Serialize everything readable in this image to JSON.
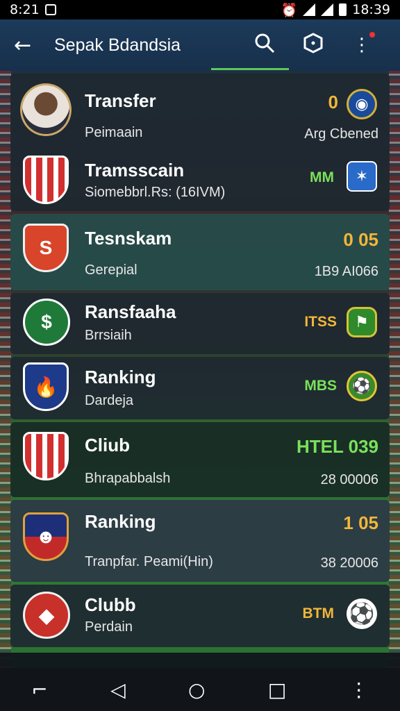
{
  "status_bar": {
    "time_left": "8:21",
    "time_right": "18:39"
  },
  "app_bar": {
    "back_icon": "arrow-left-icon",
    "title": "Sepak Bdandsia",
    "actions": [
      "search-icon",
      "shield-icon",
      "more-vert-icon"
    ]
  },
  "rows": [
    {
      "title": "Transfer",
      "subtitle": "Peimaain",
      "value": "0",
      "right_text": "Arg Cbened",
      "icon": "player-avatar"
    },
    {
      "title": "Tramsscain",
      "subtitle": "Siomebbrl.Rs: (16IVM)",
      "value": "MM",
      "icon": "club-crest"
    },
    {
      "title": "Tesnskam",
      "subtitle": "Gerepial",
      "value": "0 05",
      "right_text": "1B9 AI066",
      "icon": "club-crest"
    },
    {
      "title": "Ransfaaha",
      "subtitle": "Brrsiaih",
      "value": "ITSS",
      "icon": "club-crest"
    },
    {
      "title": "Ranking",
      "subtitle": "Dardeja",
      "value": "MBS",
      "icon": "club-crest"
    },
    {
      "title": "Cliub",
      "subtitle": "Bhrapabbalsh",
      "value": "HTEL 039",
      "right_text": "28 00006",
      "icon": "club-crest"
    },
    {
      "title": "Ranking",
      "subtitle": "Tranpfar. Peami(Hin)",
      "value": "1 05",
      "right_text": "38 20006",
      "icon": "player-crest"
    },
    {
      "title": "Clubb",
      "subtitle": "Perdain",
      "value": "BTM",
      "icon": "club-crest"
    }
  ],
  "nav_bar": [
    "recent-apps-icon",
    "back-triangle-icon",
    "home-circle-icon",
    "overview-square-icon",
    "more-vert-icon"
  ],
  "colors": {
    "accent_yellow": "#f2b63a",
    "accent_green": "#7be05a",
    "app_bar": "#1c3a5a"
  }
}
